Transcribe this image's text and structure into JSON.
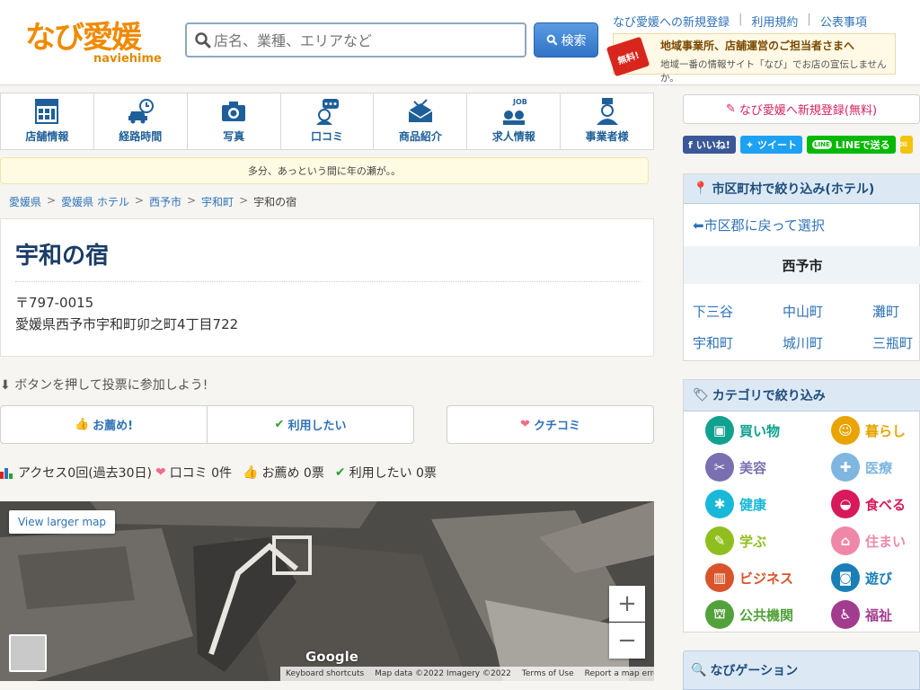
{
  "header": {
    "logo_main": "なび愛媛",
    "logo_sub": "naviehime",
    "search_placeholder": "店名、業種、エリアなど",
    "search_button": "検索",
    "top_links": [
      "なび愛媛への新規登録",
      "利用規約",
      "公表事項"
    ],
    "promo_badge": "無料!",
    "promo_title": "地域事業所、店舗運営のご担当者さまへ",
    "promo_sub": "地域一番の情報サイト「なび」でお店の宣伝しませんか。"
  },
  "nav": {
    "items": [
      {
        "label": "店舗情報",
        "icon": "info-icon"
      },
      {
        "label": "経路時間",
        "icon": "car-clock-icon"
      },
      {
        "label": "写真",
        "icon": "camera-icon"
      },
      {
        "label": "口コミ",
        "icon": "review-icon"
      },
      {
        "label": "商品紹介",
        "icon": "product-icon"
      },
      {
        "label": "求人情報",
        "icon": "job-icon"
      },
      {
        "label": "事業者様",
        "icon": "business-icon"
      }
    ],
    "job_text": "JOB"
  },
  "notice": "多分、あっという間に年の瀬が。。",
  "breadcrumb": [
    "愛媛県",
    "愛媛県 ホテル",
    "西予市",
    "宇和町",
    "宇和の宿"
  ],
  "shop": {
    "name": "宇和の宿",
    "zip": "〒797-0015",
    "address": "愛媛県西予市宇和町卯之町4丁目722"
  },
  "vote": {
    "hint": "ボタンを押して投票に参加しよう!",
    "recommend": "お薦め!",
    "want_use": "利用したい",
    "kuchikomi": "クチコミ"
  },
  "stats": {
    "access": "アクセス0回(過去30日)",
    "reviews": "口コミ 0件",
    "recommend": "お薦め 0票",
    "want_use": "利用したい 0票"
  },
  "map": {
    "larger": "View larger map",
    "zoom_in": "+",
    "zoom_out": "−",
    "google": "Google",
    "footer": [
      "Keyboard shortcuts",
      "Map data ©2022 Imagery ©2022",
      "Terms of Use",
      "Report a map error"
    ]
  },
  "right": {
    "register": "なび愛媛へ新規登録(無料)",
    "social": [
      {
        "label": "いいね!",
        "color": "#3b5998",
        "icon": "facebook-icon"
      },
      {
        "label": "ツイート",
        "color": "#1da1f2",
        "icon": "twitter-icon"
      },
      {
        "label": "LINEで送る",
        "color": "#00b900",
        "icon": "line-icon"
      }
    ],
    "line_badge": "LINE",
    "area_head": "市区町村で絞り込み(ホテル)",
    "area_back": "⬅市区郡に戻って選択",
    "area_city": "西予市",
    "areas": [
      "下三谷",
      "中山町",
      "灘町",
      "宇和町",
      "城川町",
      "三瓶町"
    ],
    "cat_head": "カテゴリで絞り込み",
    "categories": [
      {
        "label": "買い物",
        "color": "#10a28f"
      },
      {
        "label": "暮らし",
        "color": "#e9a400"
      },
      {
        "label": "美容",
        "color": "#7a6fb0"
      },
      {
        "label": "医療",
        "color": "#7fb6e0"
      },
      {
        "label": "健康",
        "color": "#18b8d9"
      },
      {
        "label": "食べる",
        "color": "#d8195b"
      },
      {
        "label": "学ぶ",
        "color": "#8fbf1f"
      },
      {
        "label": "住まい",
        "color": "#ef88a8"
      },
      {
        "label": "ビジネス",
        "color": "#d9542b"
      },
      {
        "label": "遊び",
        "color": "#1a7fb7"
      },
      {
        "label": "公共機関",
        "color": "#53a13a"
      },
      {
        "label": "福祉",
        "color": "#a23c8f"
      }
    ],
    "navi_head": "なびゲーション"
  }
}
